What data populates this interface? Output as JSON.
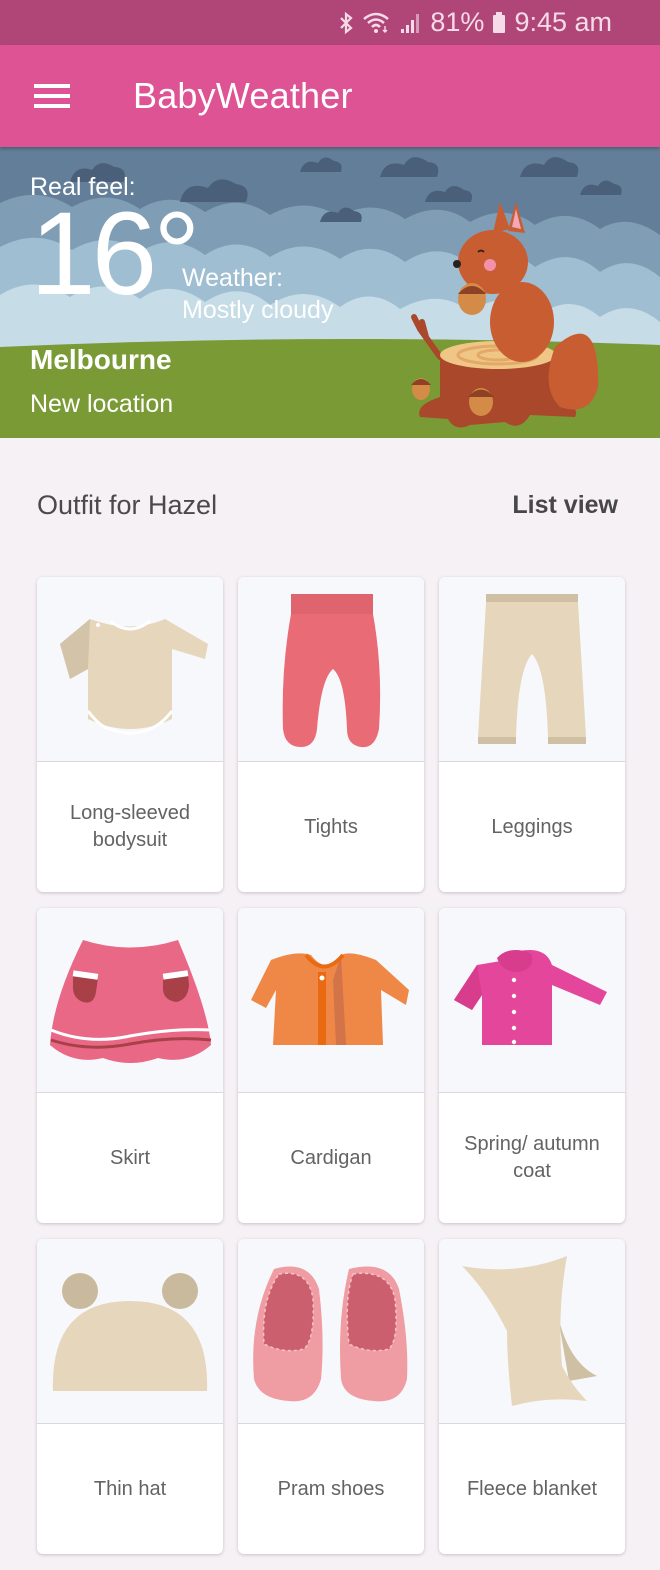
{
  "status_bar": {
    "icons": [
      "bluetooth-icon",
      "wifi-icon",
      "signal-icon",
      "battery-icon"
    ],
    "battery": "81%",
    "time": "9:45 am"
  },
  "app_bar": {
    "menu_icon": "hamburger-menu-icon",
    "title": "BabyWeather"
  },
  "hero": {
    "real_feel_label": "Real feel:",
    "temperature": "16°",
    "weather_label": "Weather:",
    "weather_value": "Mostly cloudy",
    "city": "Melbourne",
    "new_location": "New location",
    "illustration": "squirrel-on-stump"
  },
  "outfit": {
    "title": "Outfit for Hazel",
    "view_toggle": "List view",
    "items": [
      {
        "label": "Long-sleeved bodysuit",
        "icon": "bodysuit-icon",
        "color": "#e6d6bb"
      },
      {
        "label": "Tights",
        "icon": "tights-icon",
        "color": "#e96b75"
      },
      {
        "label": "Leggings",
        "icon": "leggings-icon",
        "color": "#e6d6bb"
      },
      {
        "label": "Skirt",
        "icon": "skirt-icon",
        "color": "#e86886"
      },
      {
        "label": "Cardigan",
        "icon": "cardigan-icon",
        "color": "#ef8847"
      },
      {
        "label": "Spring/ autumn coat",
        "icon": "coat-icon",
        "color": "#e3469a"
      },
      {
        "label": "Thin hat",
        "icon": "hat-icon",
        "color": "#e6d6bb"
      },
      {
        "label": "Pram shoes",
        "icon": "shoes-icon",
        "color": "#f09ca3"
      },
      {
        "label": "Fleece blanket",
        "icon": "blanket-icon",
        "color": "#e6d6bb"
      }
    ]
  },
  "colors": {
    "status_bar": "#b04678",
    "app_bar": "#dd5393",
    "background": "#f6f1f5",
    "grass": "#7a9a36",
    "sky": "#c5dbe6",
    "clouds_dark": "#5d7791"
  }
}
